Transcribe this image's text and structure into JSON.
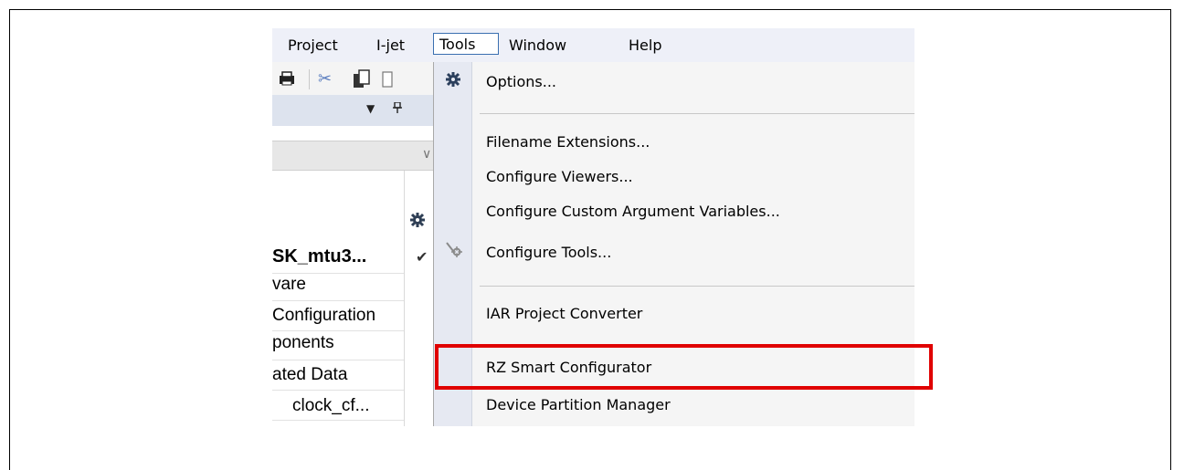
{
  "menubar": {
    "items": [
      "Project",
      "I-jet",
      "Tools",
      "Window",
      "Help"
    ]
  },
  "tree": {
    "rows": [
      "SK_mtu3...",
      "vare",
      "Configuration",
      "ponents",
      "ated Data",
      "clock_cf..."
    ]
  },
  "tools_menu": {
    "items": [
      {
        "label": "Options...",
        "icon": "gear-icon"
      },
      {
        "label": "Filename Extensions..."
      },
      {
        "label": "Configure Viewers..."
      },
      {
        "label": "Configure Custom Argument Variables..."
      },
      {
        "label": "Configure Tools...",
        "icon": "tools-icon"
      },
      {
        "label": "IAR Project Converter"
      },
      {
        "label": "RZ Smart Configurator",
        "highlighted": true
      },
      {
        "label": "Device Partition Manager"
      }
    ]
  },
  "colors": {
    "highlight_border": "#e00000",
    "menubar_bg": "#eef0f8",
    "active_menu_border": "#3a6fb0"
  }
}
